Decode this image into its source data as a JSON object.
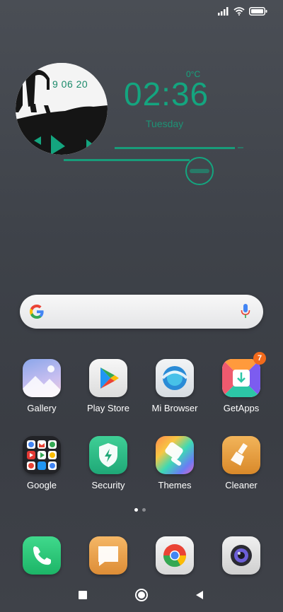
{
  "status_bar": {
    "icons": [
      "signal-icon",
      "wifi-icon",
      "battery-icon"
    ]
  },
  "widget": {
    "photo_date": "9 06 20",
    "temperature": "0°C",
    "time": "02:36",
    "day": "Tuesday",
    "accent_color": "#14a57f"
  },
  "search": {
    "logo": "google-g-icon",
    "mic": "mic-icon"
  },
  "apps": {
    "gallery": "Gallery",
    "play_store": "Play Store",
    "mi_browser": "Mi Browser",
    "getapps": "GetApps",
    "getapps_badge": "7",
    "google": "Google",
    "security": "Security",
    "themes": "Themes",
    "cleaner": "Cleaner"
  },
  "page_indicator": {
    "pages": 2,
    "current": 1
  },
  "dock": [
    "phone-icon",
    "messages-icon",
    "chrome-icon",
    "camera-icon"
  ],
  "nav": [
    "recents-button",
    "home-button",
    "back-button"
  ]
}
